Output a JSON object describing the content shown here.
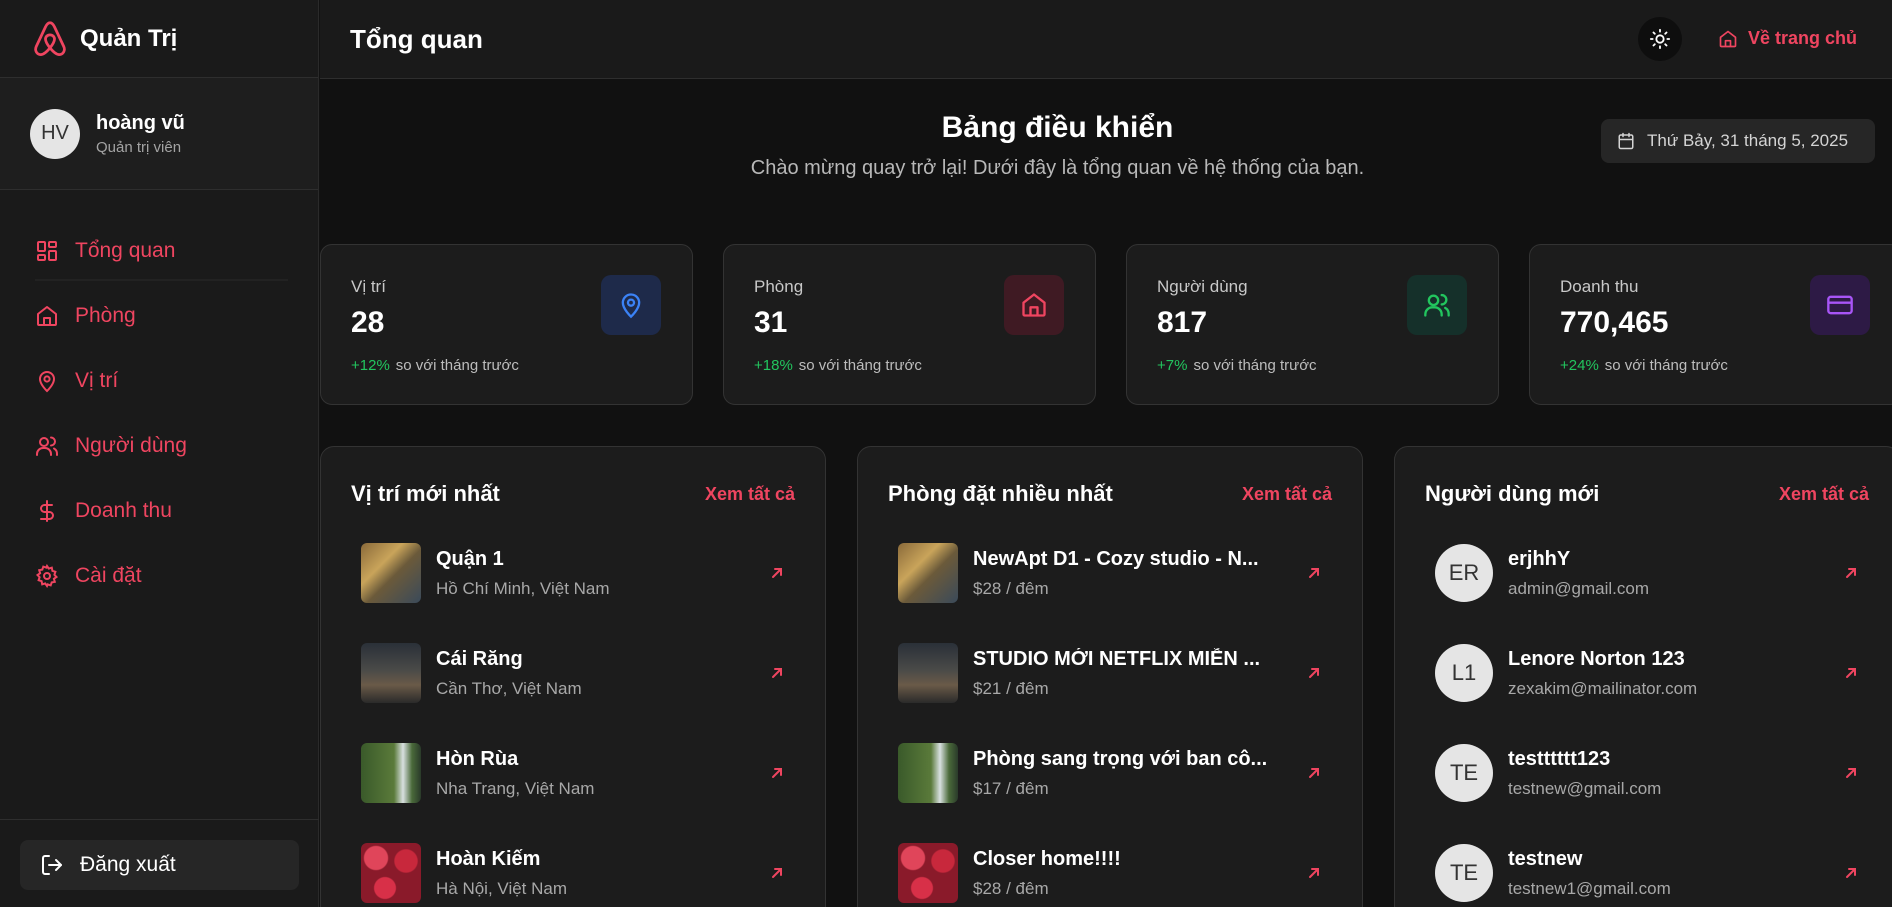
{
  "brand": {
    "title": "Quản Trị"
  },
  "user": {
    "initials": "HV",
    "name": "hoàng vũ",
    "role": "Quản trị viên"
  },
  "nav": [
    {
      "label": "Tổng quan",
      "icon": "dashboard-icon"
    },
    {
      "label": "Phòng",
      "icon": "home-icon"
    },
    {
      "label": "Vị trí",
      "icon": "location-pin-icon"
    },
    {
      "label": "Người dùng",
      "icon": "users-icon"
    },
    {
      "label": "Doanh thu",
      "icon": "dollar-icon"
    },
    {
      "label": "Cài đặt",
      "icon": "gear-icon"
    }
  ],
  "logout_label": "Đăng xuất",
  "header": {
    "title": "Tổng quan",
    "home_link": "Về trang chủ"
  },
  "dashboard": {
    "title": "Bảng điều khiển",
    "subtitle": "Chào mừng quay trở lại! Dưới đây là tổng quan về hệ thống của bạn.",
    "date": "Thứ Bảy, 31 tháng 5, 2025"
  },
  "stats": [
    {
      "label": "Vị trí",
      "value": "28",
      "delta": "+12%",
      "delta_text": "so với tháng trước",
      "icon": "location-pin-icon",
      "color": "#3b82f6"
    },
    {
      "label": "Phòng",
      "value": "31",
      "delta": "+18%",
      "delta_text": "so với tháng trước",
      "icon": "home-icon",
      "color": "#ef4560"
    },
    {
      "label": "Người dùng",
      "value": "817",
      "delta": "+7%",
      "delta_text": "so với tháng trước",
      "icon": "users-icon",
      "color": "#22c55e"
    },
    {
      "label": "Doanh thu",
      "value": "770,465",
      "delta": "+24%",
      "delta_text": "so với tháng trước",
      "icon": "credit-card-icon",
      "color": "#a855f7"
    }
  ],
  "panels": {
    "locations": {
      "title": "Vị trí mới nhất",
      "see_all": "Xem tất cả",
      "items": [
        {
          "title": "Quận 1",
          "sub": "Hồ Chí Minh, Việt Nam"
        },
        {
          "title": "Cái Răng",
          "sub": "Cần Thơ, Việt Nam"
        },
        {
          "title": "Hòn Rùa",
          "sub": "Nha Trang, Việt Nam"
        },
        {
          "title": "Hoàn Kiếm",
          "sub": "Hà Nội, Việt Nam"
        }
      ]
    },
    "rooms": {
      "title": "Phòng đặt nhiều nhất",
      "see_all": "Xem tất cả",
      "items": [
        {
          "title": "NewApt D1 - Cozy studio - N...",
          "sub": "$28 / đêm"
        },
        {
          "title": "STUDIO MỚI NETFLIX MIỄN ...",
          "sub": "$21 / đêm"
        },
        {
          "title": "Phòng sang trọng với ban cô...",
          "sub": "$17 / đêm"
        },
        {
          "title": "Closer home!!!!",
          "sub": "$28 / đêm"
        }
      ]
    },
    "users": {
      "title": "Người dùng mới",
      "see_all": "Xem tất cả",
      "items": [
        {
          "initials": "ER",
          "title": "erjhhY",
          "sub": "admin@gmail.com"
        },
        {
          "initials": "L1",
          "title": "Lenore Norton 123",
          "sub": "zexakim@mailinator.com"
        },
        {
          "initials": "TE",
          "title": "testttttt123",
          "sub": "testnew@gmail.com"
        },
        {
          "initials": "TE",
          "title": "testnew",
          "sub": "testnew1@gmail.com"
        }
      ]
    }
  }
}
